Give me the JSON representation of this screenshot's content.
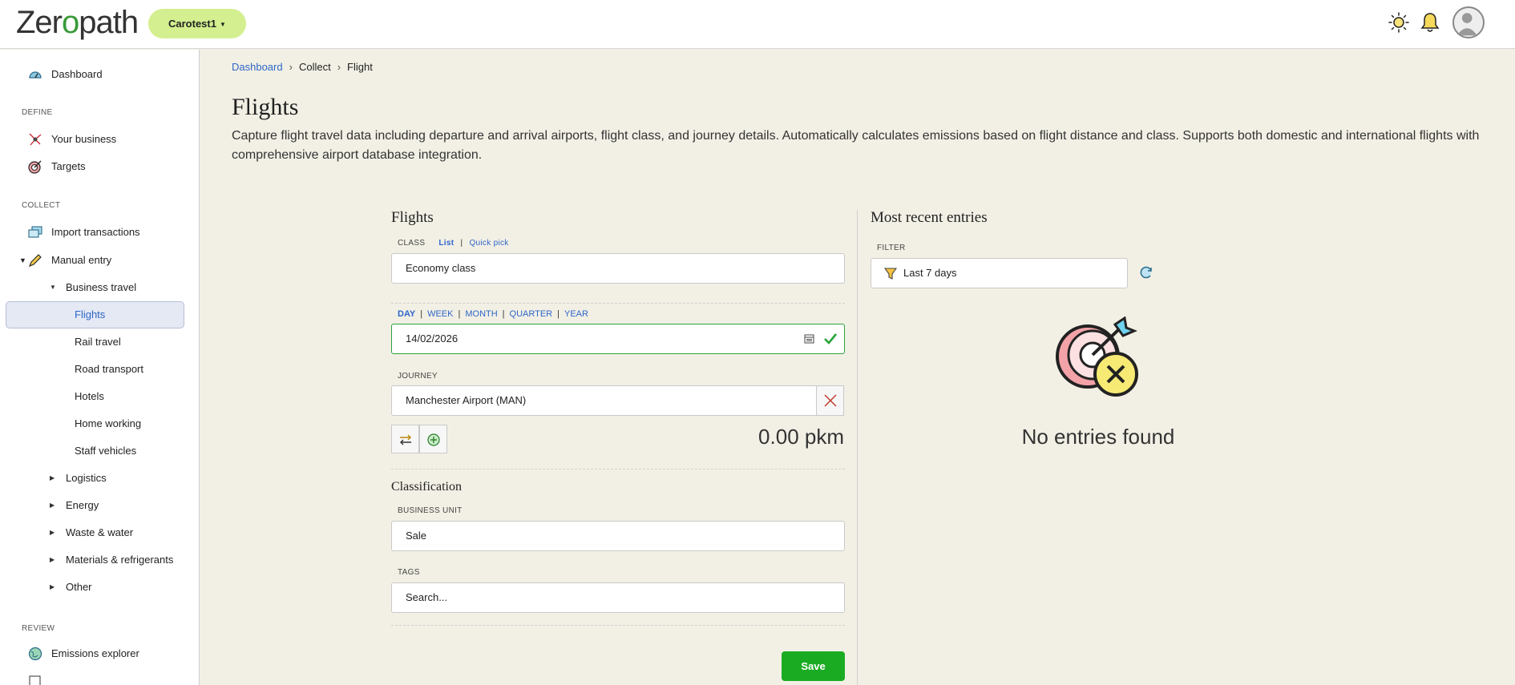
{
  "header": {
    "logo_text_a": "Zer",
    "logo_text_b": "o",
    "logo_text_c": "path",
    "org_label": "Carotest1",
    "icons": [
      "sun-icon",
      "bell-icon",
      "avatar"
    ]
  },
  "sidebar": {
    "dashboard": "Dashboard",
    "section_define": "DEFINE",
    "your_business": "Your business",
    "targets": "Targets",
    "section_collect": "COLLECT",
    "import_transactions": "Import transactions",
    "manual_entry": "Manual entry",
    "business_travel": "Business travel",
    "flights": "Flights",
    "rail_travel": "Rail travel",
    "road_transport": "Road transport",
    "hotels": "Hotels",
    "home_working": "Home working",
    "staff_vehicles": "Staff vehicles",
    "logistics": "Logistics",
    "energy": "Energy",
    "waste_water": "Waste & water",
    "materials_refrigerants": "Materials & refrigerants",
    "other": "Other",
    "section_review": "REVIEW",
    "emissions_explorer": "Emissions explorer"
  },
  "breadcrumb": {
    "dashboard": "Dashboard",
    "collect": "Collect",
    "flight": "Flight",
    "sep": "›"
  },
  "page": {
    "title": "Flights",
    "description": "Capture flight travel data including departure and arrival airports, flight class, and journey details. Automatically calculates emissions based on flight distance and class. Supports both domestic and international flights with comprehensive airport database integration."
  },
  "form": {
    "title": "Flights",
    "class_label": "CLASS",
    "class_mode_list": "List",
    "class_mode_sep": "|",
    "class_mode_quick": "Quick pick",
    "class_value": "Economy class",
    "period_day": "DAY",
    "period_week": "WEEK",
    "period_month": "MONTH",
    "period_quarter": "QUARTER",
    "period_year": "YEAR",
    "period_sep": "|",
    "date_value": "14/02/2026",
    "journey_label": "JOURNEY",
    "journey_value": "Manchester Airport (MAN)",
    "distance": "0.00 pkm",
    "classification_title": "Classification",
    "business_unit_label": "BUSINESS UNIT",
    "business_unit_value": "Sale",
    "tags_label": "TAGS",
    "tags_placeholder": "Search...",
    "save_label": "Save"
  },
  "recent": {
    "title": "Most recent entries",
    "filter_label": "FILTER",
    "filter_value": "Last 7 days",
    "empty_text": "No entries found"
  },
  "colors": {
    "accent_blue": "#2f66c8",
    "save_green": "#1bab23",
    "org_pill": "#d4ef8f",
    "page_bg": "#f2f0e5"
  }
}
